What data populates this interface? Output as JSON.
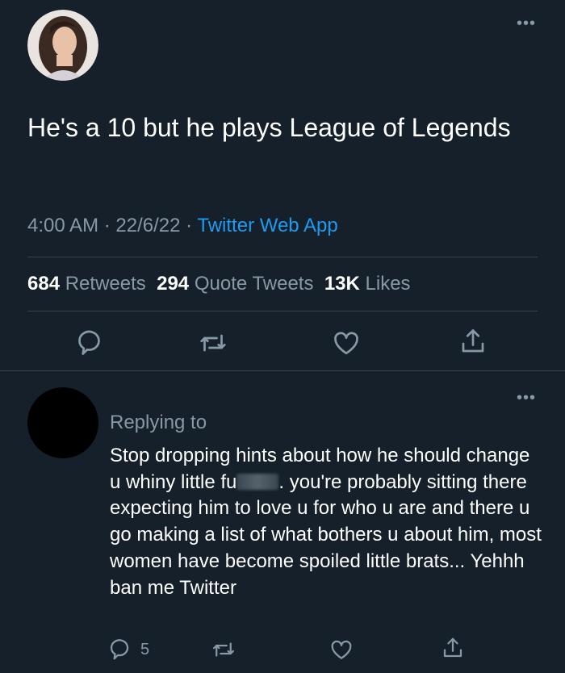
{
  "main_tweet": {
    "text": "He's a 10 but he plays League of Legends",
    "time": "4:00 AM",
    "separator": "·",
    "date": "22/6/22",
    "source": "Twitter Web App",
    "stats": {
      "retweets_count": "684",
      "retweets_label": "Retweets",
      "quotes_count": "294",
      "quotes_label": "Quote Tweets",
      "likes_count": "13K",
      "likes_label": "Likes"
    },
    "more_icon": "more-dots-icon"
  },
  "reply": {
    "replying_label": "Replying to",
    "text_before_blur": "Stop dropping hints about how he should change u whiny little fu",
    "text_after_blur": ". you're probably sitting there expecting him to love u for who u are and there u go making a list of what bothers u about him, most women have become spoiled little brats... Yehhh ban me Twitter",
    "reply_count": "5"
  },
  "icons": [
    "reply-icon",
    "retweet-icon",
    "like-icon",
    "share-icon"
  ],
  "colors": {
    "background": "#15202b",
    "muted": "#8899a6",
    "link": "#1d9bf0",
    "divider": "#38444d"
  }
}
